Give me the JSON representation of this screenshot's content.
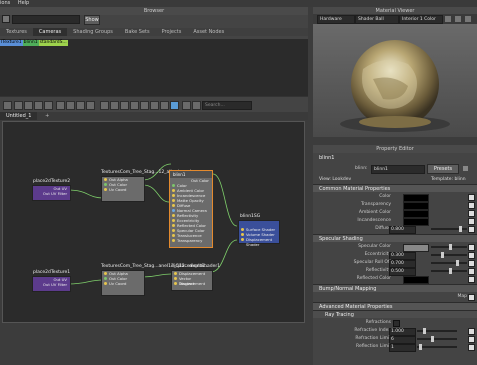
{
  "menu": {
    "items": [
      "ions",
      "Help"
    ]
  },
  "browser": {
    "title": "Browser",
    "show_button": "Show",
    "tabs": [
      "Textures",
      "Cameras",
      "Shading Groups",
      "Bake Sets",
      "Projects",
      "Asset Nodes"
    ],
    "chips": [
      "ITexture1",
      "blinn1",
      "standardS..."
    ]
  },
  "graph": {
    "tab": "Untitled_1",
    "add_tab": "+",
    "search_placeholder": "Search...",
    "nodes": {
      "place2d_a": {
        "title": "place2dTexture2",
        "ports": [
          "Out UV",
          "Out UV Filter"
        ]
      },
      "place2d_b": {
        "title": "place2dTexture1",
        "ports": [
          "Out UV",
          "Out UV Filter"
        ]
      },
      "file_a": {
        "title": "TexturesCom_Tree_Stag...12_albedo_w_hy...",
        "ports": [
          "Out Alpha",
          "Out Color",
          "Uv Coord"
        ]
      },
      "file_b": {
        "title": "TexturesCom_Tree_Stag...anel13_512...displac...",
        "ports": [
          "Out Alpha",
          "Out Color",
          "Uv Coord"
        ]
      },
      "blinn_in": {
        "title": "blinn1",
        "ports": [
          "Out Color",
          "Color",
          "Ambient Color",
          "Incandescence",
          "Matte Opacity",
          "Diffuse",
          "Normal Camera",
          "Reflectivity",
          "Eccentricity",
          "Reflected Color",
          "Specular Color",
          "Translucence",
          "Transparency"
        ]
      },
      "disp": {
        "title": "displacementShader1",
        "ports": [
          "Displacement",
          "Vector Displacement",
          "Tangent"
        ]
      },
      "sg": {
        "title": "blinn1SG",
        "ports": [
          "Surface Shader",
          "Volume Shader",
          "Displacement Shader"
        ]
      }
    }
  },
  "material_viewer": {
    "title": "Material Viewer",
    "renderer": "Hardware",
    "geometry": "Shader Ball",
    "environment": "Interior 1 Color"
  },
  "property_editor": {
    "title": "Property Editor",
    "node_name": "blinn1",
    "field_label": "blinn:",
    "field_value": "blinn1",
    "presets": "Presets",
    "view_label": "View: Lookdev",
    "template": "Template: blinn",
    "sections": {
      "common": "Common Material Properties",
      "specular": "Specular Shading",
      "bump": "Bump/Normal Mapping",
      "advanced": "Advanced Material Properties",
      "raytracing": "Ray Tracing"
    },
    "common_rows": [
      {
        "label": "Color"
      },
      {
        "label": "Transparency"
      },
      {
        "label": "Ambient Color"
      },
      {
        "label": "Incandescence"
      },
      {
        "label": "Diffuse",
        "value": "0.800"
      }
    ],
    "specular_rows": [
      {
        "label": "Specular Color"
      },
      {
        "label": "Eccentricity",
        "value": "0.300"
      },
      {
        "label": "Specular Roll Off",
        "value": "0.700"
      },
      {
        "label": "Reflectivity",
        "value": "0.500"
      },
      {
        "label": "Reflected Color"
      }
    ],
    "bump_row": {
      "label": "Map"
    },
    "ray_rows": [
      {
        "label": "Refractions"
      },
      {
        "label": "Refractive Index",
        "value": "1.000"
      },
      {
        "label": "Refraction Limit",
        "value": "6"
      },
      {
        "label": "Reflection Limit",
        "value": "1"
      }
    ]
  }
}
